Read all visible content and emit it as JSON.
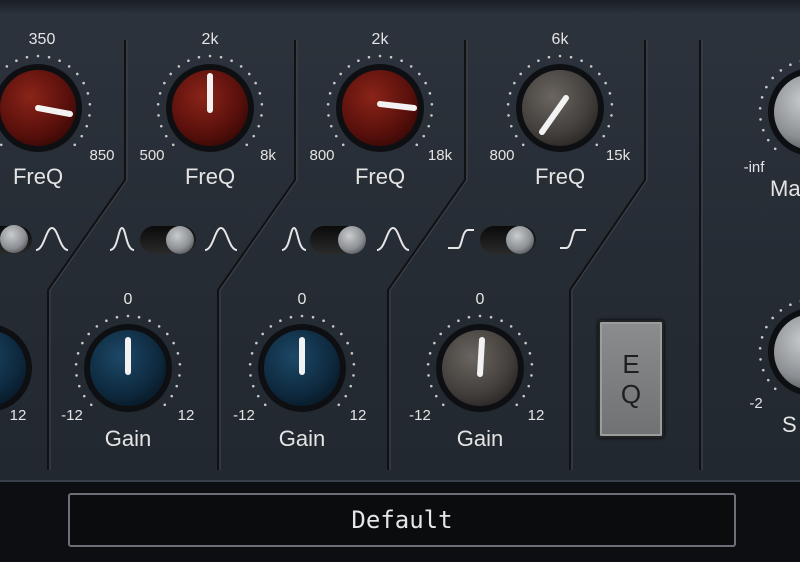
{
  "bands": [
    {
      "freq": {
        "top": "350",
        "min": "",
        "max": "850",
        "label": "FreQ",
        "color": "red"
      },
      "gain": {
        "top": "",
        "min": "",
        "max": "12",
        "label": ""
      }
    },
    {
      "freq": {
        "top": "2k",
        "min": "500",
        "max": "8k",
        "label": "FreQ",
        "color": "red"
      },
      "gain": {
        "top": "0",
        "min": "-12",
        "max": "12",
        "label": "Gain",
        "color": "blue"
      }
    },
    {
      "freq": {
        "top": "2k",
        "min": "800",
        "max": "18k",
        "label": "FreQ",
        "color": "red"
      },
      "gain": {
        "top": "0",
        "min": "-12",
        "max": "12",
        "label": "Gain",
        "color": "blue"
      }
    },
    {
      "freq": {
        "top": "6k",
        "min": "800",
        "max": "15k",
        "label": "FreQ",
        "color": "gray"
      },
      "gain": {
        "top": "0",
        "min": "-12",
        "max": "12",
        "label": "Gain",
        "color": "gray"
      }
    }
  ],
  "right": {
    "master": {
      "min": "-inf",
      "label": "Ma"
    },
    "second": {
      "min": "-2",
      "label": "S"
    }
  },
  "eq_button": {
    "line1": "E",
    "line2": "Q"
  },
  "preset": {
    "value": "Default"
  },
  "colors": {
    "knob_red": "#6a130f",
    "knob_blue": "#0f2f47",
    "knob_gray": "#4a4643",
    "panel": "#2a3038"
  }
}
